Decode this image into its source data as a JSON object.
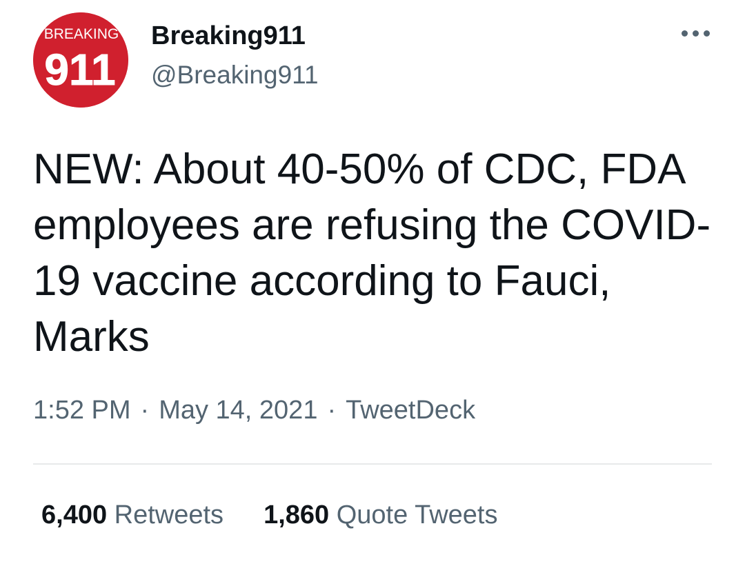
{
  "tweet": {
    "author": {
      "display_name": "Breaking911",
      "handle": "@Breaking911",
      "avatar": {
        "icon": "breaking911-logo",
        "top_text": "BREAKING",
        "number": "911",
        "background_color": "#d0202e"
      }
    },
    "more_icon": "ellipsis-icon",
    "text": "NEW: About 40-50% of CDC, FDA employees are refusing the COVID-19 vaccine according to Fauci, Marks",
    "time": "1:52 PM",
    "separator": "·",
    "date": "May 14, 2021",
    "source": "TweetDeck"
  },
  "stats": {
    "retweets_count": "6,400",
    "retweets_label": "Retweets",
    "quote_tweets_count": "1,860",
    "quote_tweets_label": "Quote Tweets"
  },
  "colors": {
    "primary_text": "#0f1419",
    "secondary_text": "#536471",
    "divider": "#e7e9ea"
  }
}
